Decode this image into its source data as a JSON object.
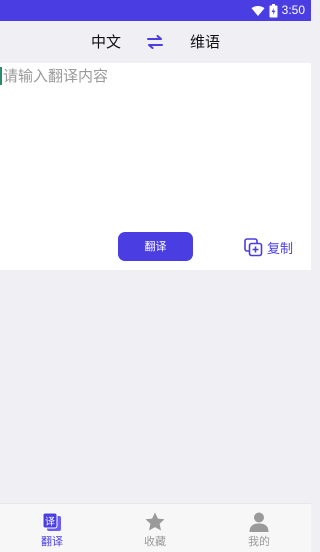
{
  "status_bar": {
    "time": "3:50",
    "icons": [
      "wifi-icon",
      "battery-icon"
    ],
    "color": "#4a3de2"
  },
  "language_bar": {
    "source_language": "中文",
    "target_language": "维语",
    "swap_icon": "swap-icon"
  },
  "input": {
    "value": "",
    "placeholder": "请输入翻译内容"
  },
  "actions": {
    "translate_label": "翻译",
    "copy_label": "复制",
    "copy_icon": "copy-icon"
  },
  "tabs": [
    {
      "label": "翻译",
      "icon": "translate-icon",
      "active": true
    },
    {
      "label": "收藏",
      "icon": "star-icon",
      "active": false
    },
    {
      "label": "我的",
      "icon": "person-icon",
      "active": false
    }
  ],
  "colors": {
    "accent": "#4a3de2",
    "background": "#f0eff4",
    "inactive": "#9a9a9a"
  }
}
